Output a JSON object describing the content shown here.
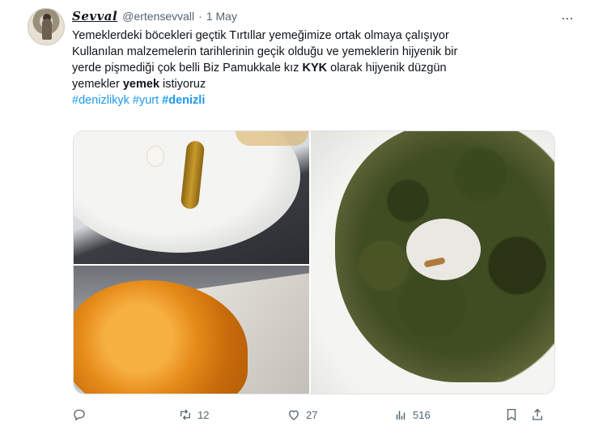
{
  "tweet": {
    "display_name": "Sevval",
    "handle": "@ertensevvall",
    "separator": "·",
    "date": "1 May",
    "more_icon": "more-dots-icon",
    "text": {
      "line1": "Yemeklerdeki böcekleri  geçtik Tırtıllar yemeğimize ortak olmaya çalışıyor",
      "line2": "Kullanılan malzemelerin tarihlerinin geçik olduğu ve yemeklerin hijyenik bir",
      "line3": "yerde pişmediği çok belli Biz Pamukkale kız ",
      "line3_bold": "KYK",
      "line3_end": " olarak hijyenik düzgün",
      "line4": "yemekler ",
      "line4_bold": "yemek",
      "line4_end": " istiyoruz"
    },
    "hashtags": [
      "#denizlikyk",
      "#yurt",
      "#denizli"
    ],
    "actions": {
      "reply": {
        "icon": "reply-icon",
        "count": ""
      },
      "retweet": {
        "icon": "retweet-icon",
        "count": "12"
      },
      "like": {
        "icon": "heart-icon",
        "count": "27"
      },
      "views": {
        "icon": "views-chart-icon",
        "count": "516"
      },
      "bookmark": {
        "icon": "bookmark-icon"
      },
      "share": {
        "icon": "share-icon"
      }
    }
  }
}
